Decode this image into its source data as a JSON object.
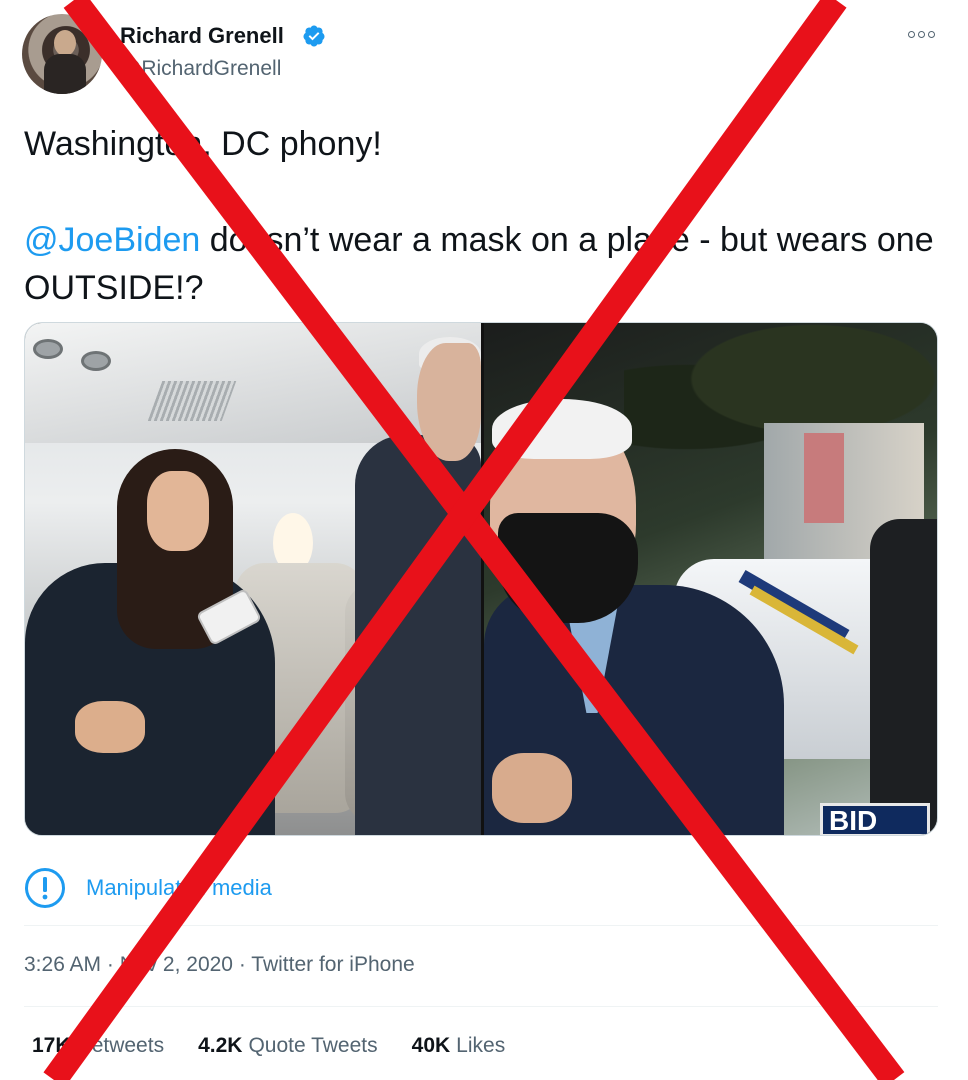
{
  "author": {
    "name": "Richard Grenell",
    "handle": "@RichardGrenell"
  },
  "tweet": {
    "line1": "Washington, DC phony!",
    "mention": "@JoeBiden",
    "line2_rest": " doesn’t wear a mask on a plane - but wears one OUTSIDE!?"
  },
  "media": {
    "right_sign_text": "BID"
  },
  "media_label": "Manipulated media",
  "meta": {
    "time": "3:26 AM",
    "date": "Nov 2, 2020",
    "source": "Twitter for iPhone",
    "separator": " · "
  },
  "stats": [
    {
      "value": "17K",
      "label": "Retweets"
    },
    {
      "value": "4.2K",
      "label": "Quote Tweets"
    },
    {
      "value": "40K",
      "label": "Likes"
    }
  ],
  "icons": {
    "verified": "verified-badge-icon",
    "more": "more-options-icon",
    "info": "info-circle-icon"
  },
  "colors": {
    "accent": "#1d9bf0",
    "text": "#0f1419",
    "secondary": "#536471",
    "overlay_cross": "#e8111a"
  }
}
